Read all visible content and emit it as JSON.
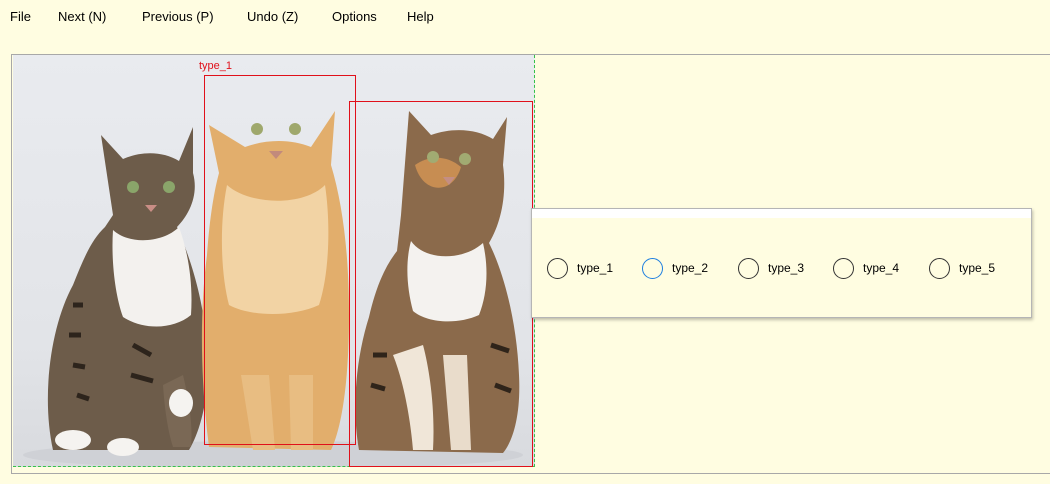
{
  "menu": {
    "file": "File",
    "next": "Next (N)",
    "previous": "Previous (P)",
    "undo": "Undo (Z)",
    "options": "Options",
    "help": "Help"
  },
  "annotations": [
    {
      "label": "type_1"
    },
    {
      "label": ""
    }
  ],
  "label_panel": {
    "options": [
      "type_1",
      "type_2",
      "type_3",
      "type_4",
      "type_5"
    ],
    "focused_option": "type_2"
  },
  "colors": {
    "background": "#fffde1",
    "bbox": "#e0101a",
    "guide": "#35c24a",
    "focus": "#1e7fe0"
  },
  "icons": {
    "photo": "three-cats-photo"
  }
}
